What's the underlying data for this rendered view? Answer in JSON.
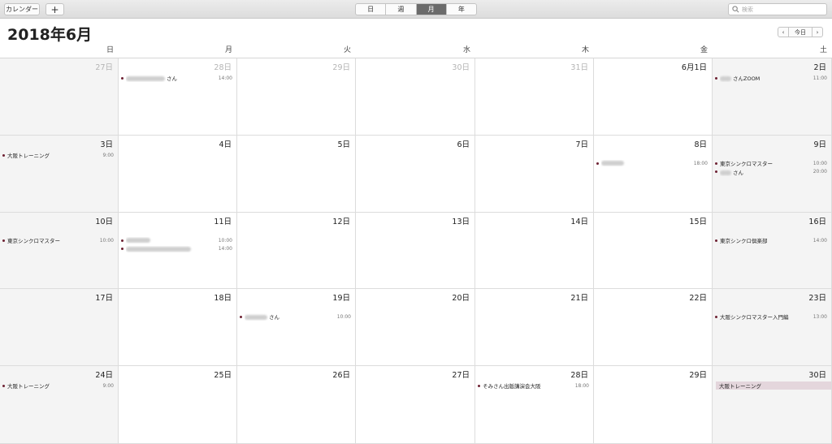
{
  "toolbar": {
    "calendars_label": "カレンダー",
    "add_label": "+",
    "views": [
      "日",
      "週",
      "月",
      "年"
    ],
    "active_view": "月",
    "search_placeholder": "検索"
  },
  "header": {
    "title": "2018年6月",
    "nav": {
      "prev": "‹",
      "today": "今日",
      "next": "›"
    }
  },
  "weekdays": [
    "日",
    "月",
    "火",
    "水",
    "木",
    "金",
    "土"
  ],
  "colors": {
    "event_dot": "#6e2233",
    "allday_bg": "#e4d6dc",
    "weekend_bg": "#f4f4f4"
  },
  "weeks": [
    [
      {
        "day": "27日",
        "muted": true,
        "events": []
      },
      {
        "day": "28日",
        "muted": true,
        "events": [
          {
            "title": "さん",
            "time": "14:00",
            "blur": 48
          }
        ]
      },
      {
        "day": "29日",
        "muted": true,
        "events": []
      },
      {
        "day": "30日",
        "muted": true,
        "events": []
      },
      {
        "day": "31日",
        "muted": true,
        "events": []
      },
      {
        "day": "6月1日",
        "muted": false,
        "events": []
      },
      {
        "day": "2日",
        "muted": false,
        "events": [
          {
            "title": "さんZOOM",
            "time": "11:00",
            "blur": 14
          }
        ]
      }
    ],
    [
      {
        "day": "3日",
        "muted": false,
        "events": [
          {
            "title": "大阪トレーニング",
            "time": "9:00"
          }
        ]
      },
      {
        "day": "4日",
        "muted": false,
        "events": []
      },
      {
        "day": "5日",
        "muted": false,
        "events": []
      },
      {
        "day": "6日",
        "muted": false,
        "events": []
      },
      {
        "day": "7日",
        "muted": false,
        "events": []
      },
      {
        "day": "8日",
        "muted": false,
        "offset": 1,
        "events": [
          {
            "title": "",
            "time": "18:00",
            "blur": 28
          }
        ]
      },
      {
        "day": "9日",
        "muted": false,
        "offset": 1,
        "events": [
          {
            "title": "東京シンクロマスター",
            "time": "10:00"
          },
          {
            "title": "さん",
            "time": "20:00",
            "blur": 14
          }
        ]
      }
    ],
    [
      {
        "day": "10日",
        "muted": false,
        "offset": 1,
        "events": [
          {
            "title": "東京シンクロマスター",
            "time": "10:00"
          }
        ]
      },
      {
        "day": "11日",
        "muted": false,
        "offset": 1,
        "events": [
          {
            "title": "",
            "time": "10:00",
            "blur": 30
          },
          {
            "title": "",
            "time": "14:00",
            "blur": 80
          }
        ]
      },
      {
        "day": "12日",
        "muted": false,
        "events": []
      },
      {
        "day": "13日",
        "muted": false,
        "events": []
      },
      {
        "day": "14日",
        "muted": false,
        "events": []
      },
      {
        "day": "15日",
        "muted": false,
        "events": []
      },
      {
        "day": "16日",
        "muted": false,
        "offset": 1,
        "events": [
          {
            "title": "東京シンクロ倶楽部",
            "time": "14:00"
          }
        ]
      }
    ],
    [
      {
        "day": "17日",
        "muted": false,
        "events": []
      },
      {
        "day": "18日",
        "muted": false,
        "events": []
      },
      {
        "day": "19日",
        "muted": false,
        "offset": 1,
        "events": [
          {
            "title": "さん",
            "time": "10:00",
            "blur": 28
          }
        ]
      },
      {
        "day": "20日",
        "muted": false,
        "events": []
      },
      {
        "day": "21日",
        "muted": false,
        "events": []
      },
      {
        "day": "22日",
        "muted": false,
        "events": []
      },
      {
        "day": "23日",
        "muted": false,
        "offset": 1,
        "events": [
          {
            "title": "大阪シンクロマスター入門編",
            "time": "13:00"
          }
        ]
      }
    ],
    [
      {
        "day": "24日",
        "muted": false,
        "events": [
          {
            "title": "大阪トレーニング",
            "time": "9:00"
          }
        ]
      },
      {
        "day": "25日",
        "muted": false,
        "events": []
      },
      {
        "day": "26日",
        "muted": false,
        "events": []
      },
      {
        "day": "27日",
        "muted": false,
        "events": []
      },
      {
        "day": "28日",
        "muted": false,
        "events": [
          {
            "title": "そみさん出版講演会大阪",
            "time": "18:00"
          }
        ]
      },
      {
        "day": "29日",
        "muted": false,
        "events": []
      },
      {
        "day": "30日",
        "muted": false,
        "events": [
          {
            "title": "大阪トレーニング",
            "allday": true
          }
        ]
      }
    ]
  ]
}
